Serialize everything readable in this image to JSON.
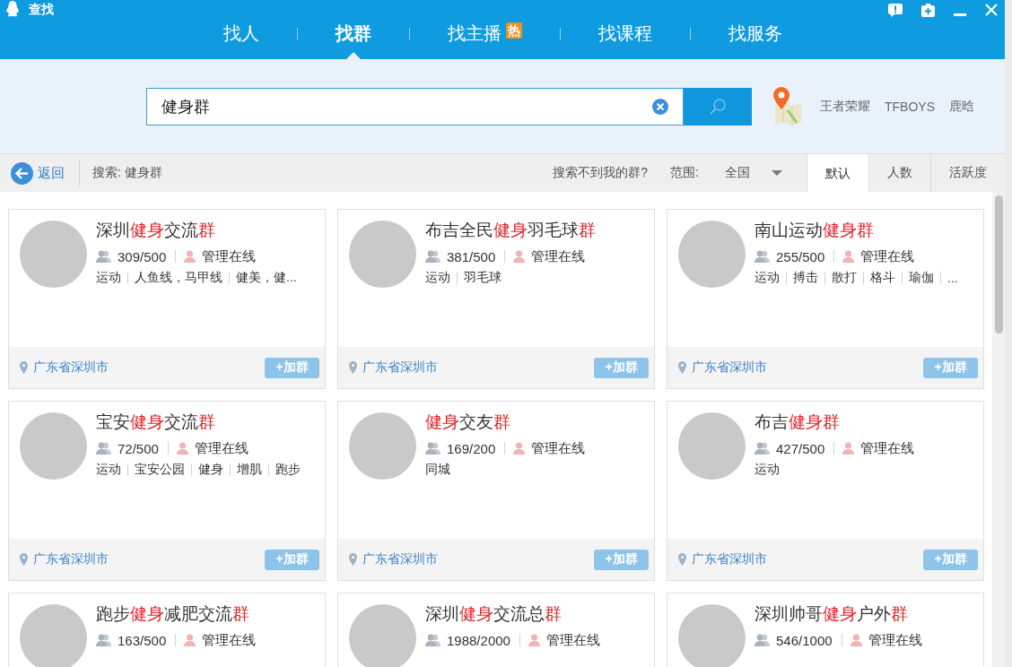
{
  "window": {
    "title": "查找"
  },
  "nav_tabs": [
    {
      "label": "找人",
      "selected": false
    },
    {
      "label": "找群",
      "selected": true
    },
    {
      "label": "找主播",
      "selected": false,
      "badge": "热"
    },
    {
      "label": "找课程",
      "selected": false
    },
    {
      "label": "找服务",
      "selected": false
    }
  ],
  "search": {
    "value": "健身群"
  },
  "hot_keywords": [
    "王者荣耀",
    "TFBOYS",
    "鹿晗"
  ],
  "toolbar": {
    "back": "返回",
    "query": "搜索: 健身群",
    "help_link": "搜索不到我的群?",
    "scope_label": "范围:",
    "scope_value": "全国"
  },
  "sort_tabs": [
    {
      "label": "默认",
      "selected": true
    },
    {
      "label": "人数",
      "selected": false
    },
    {
      "label": "活跃度",
      "selected": false
    }
  ],
  "groups": [
    {
      "title": [
        {
          "text": "深圳",
          "highlight": false
        },
        {
          "text": "健身",
          "highlight": true
        },
        {
          "text": "交流",
          "highlight": false
        },
        {
          "text": "群",
          "highlight": true
        }
      ],
      "members": "309/500",
      "admin_status": "管理在线",
      "tags": [
        "运动",
        "人鱼线，马甲线",
        "健美，健..."
      ],
      "location": "广东省深圳市",
      "join_button": "+加群"
    },
    {
      "title": [
        {
          "text": "布吉全民",
          "highlight": false
        },
        {
          "text": "健身",
          "highlight": true
        },
        {
          "text": "羽毛球",
          "highlight": false
        },
        {
          "text": "群",
          "highlight": true
        }
      ],
      "members": "381/500",
      "admin_status": "管理在线",
      "tags": [
        "运动",
        "羽毛球"
      ],
      "location": "广东省深圳市",
      "join_button": "+加群"
    },
    {
      "title": [
        {
          "text": "南山运动",
          "highlight": false
        },
        {
          "text": "健身群",
          "highlight": true
        }
      ],
      "members": "255/500",
      "admin_status": "管理在线",
      "tags": [
        "运动",
        "搏击",
        "散打",
        "格斗",
        "瑜伽",
        "..."
      ],
      "location": "广东省深圳市",
      "join_button": "+加群"
    },
    {
      "title": [
        {
          "text": "宝安",
          "highlight": false
        },
        {
          "text": "健身",
          "highlight": true
        },
        {
          "text": "交流",
          "highlight": false
        },
        {
          "text": "群",
          "highlight": true
        }
      ],
      "members": "72/500",
      "admin_status": "管理在线",
      "tags": [
        "运动",
        "宝安公园",
        "健身",
        "增肌",
        "跑步"
      ],
      "location": "广东省深圳市",
      "join_button": "+加群"
    },
    {
      "title": [
        {
          "text": "健身",
          "highlight": true
        },
        {
          "text": "交友",
          "highlight": false
        },
        {
          "text": "群",
          "highlight": true
        }
      ],
      "members": "169/200",
      "admin_status": "管理在线",
      "tags": [
        "同城"
      ],
      "location": "广东省深圳市",
      "join_button": "+加群"
    },
    {
      "title": [
        {
          "text": "布吉",
          "highlight": false
        },
        {
          "text": "健身群",
          "highlight": true
        }
      ],
      "members": "427/500",
      "admin_status": "管理在线",
      "tags": [
        "运动"
      ],
      "location": "广东省深圳市",
      "join_button": "+加群"
    },
    {
      "title": [
        {
          "text": "跑步",
          "highlight": false
        },
        {
          "text": "健身",
          "highlight": true
        },
        {
          "text": "减肥交流",
          "highlight": false
        },
        {
          "text": "群",
          "highlight": true
        }
      ],
      "members": "163/500",
      "admin_status": "管理在线"
    },
    {
      "title": [
        {
          "text": "深圳",
          "highlight": false
        },
        {
          "text": "健身",
          "highlight": true
        },
        {
          "text": "交流总",
          "highlight": false
        },
        {
          "text": "群",
          "highlight": true
        }
      ],
      "members": "1988/2000",
      "admin_status": "管理在线"
    },
    {
      "title": [
        {
          "text": "深圳帅哥",
          "highlight": false
        },
        {
          "text": "健身",
          "highlight": true
        },
        {
          "text": "户外",
          "highlight": false
        },
        {
          "text": "群",
          "highlight": true
        }
      ],
      "members": "546/1000",
      "admin_status": "管理在线"
    }
  ]
}
